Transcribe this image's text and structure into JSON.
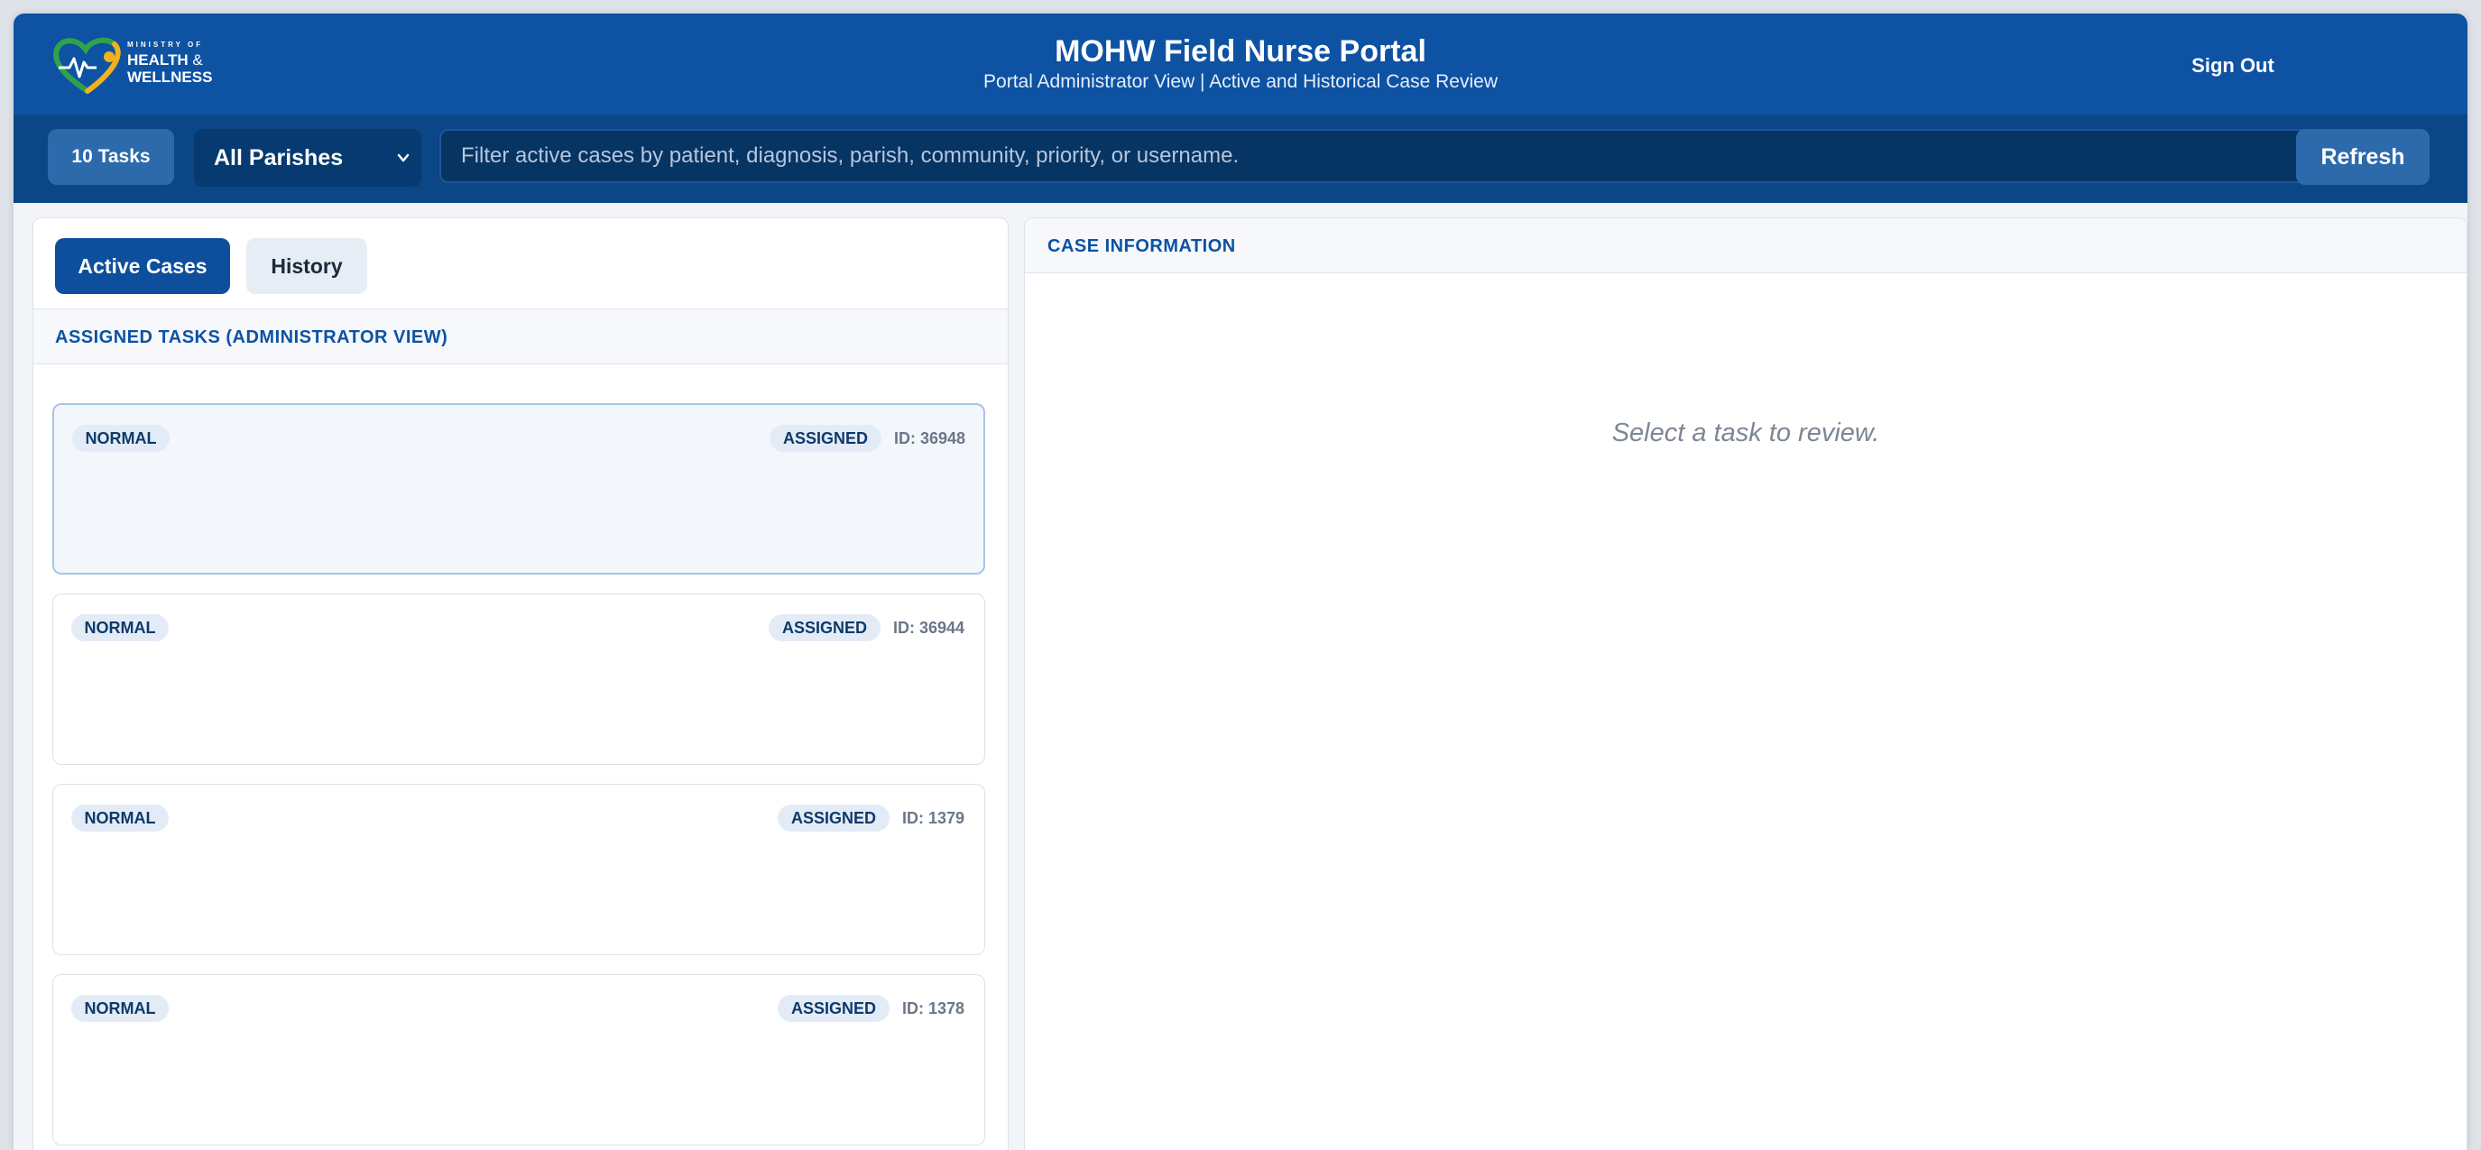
{
  "header": {
    "logo": {
      "line1": "MINISTRY OF",
      "line2": "HEALTH",
      "amp": "&",
      "line3": "WELLNESS"
    },
    "title": "MOHW Field Nurse Portal",
    "subtitle": "Portal Administrator View | Active and Historical Case Review",
    "sign_out_label": "Sign Out"
  },
  "toolbar": {
    "task_count_label": "10 Tasks",
    "parish_selected": "All Parishes",
    "filter_placeholder": "Filter active cases by patient, diagnosis, parish, community, priority, or username.",
    "refresh_label": "Refresh"
  },
  "tabs": [
    {
      "label": "Active Cases",
      "active": true
    },
    {
      "label": "History",
      "active": false
    }
  ],
  "task_list": {
    "heading": "ASSIGNED TASKS (ADMINISTRATOR VIEW)",
    "tasks": [
      {
        "priority": "NORMAL",
        "status": "ASSIGNED",
        "id_label": "ID: 36948",
        "selected": true
      },
      {
        "priority": "NORMAL",
        "status": "ASSIGNED",
        "id_label": "ID: 36944",
        "selected": false
      },
      {
        "priority": "NORMAL",
        "status": "ASSIGNED",
        "id_label": "ID: 1379",
        "selected": false
      },
      {
        "priority": "NORMAL",
        "status": "ASSIGNED",
        "id_label": "ID: 1378",
        "selected": false
      }
    ]
  },
  "case_panel": {
    "heading": "CASE INFORMATION",
    "empty_message": "Select a task to review."
  },
  "colors": {
    "header_bg": "#0d52a3",
    "toolbar_bg": "#0b4786",
    "accent": "#0d52a3",
    "pill_bg": "#e3ecf6"
  },
  "icons": {
    "logo": "heart-pulse-logo",
    "parish_dropdown": "chevron-down-icon"
  }
}
